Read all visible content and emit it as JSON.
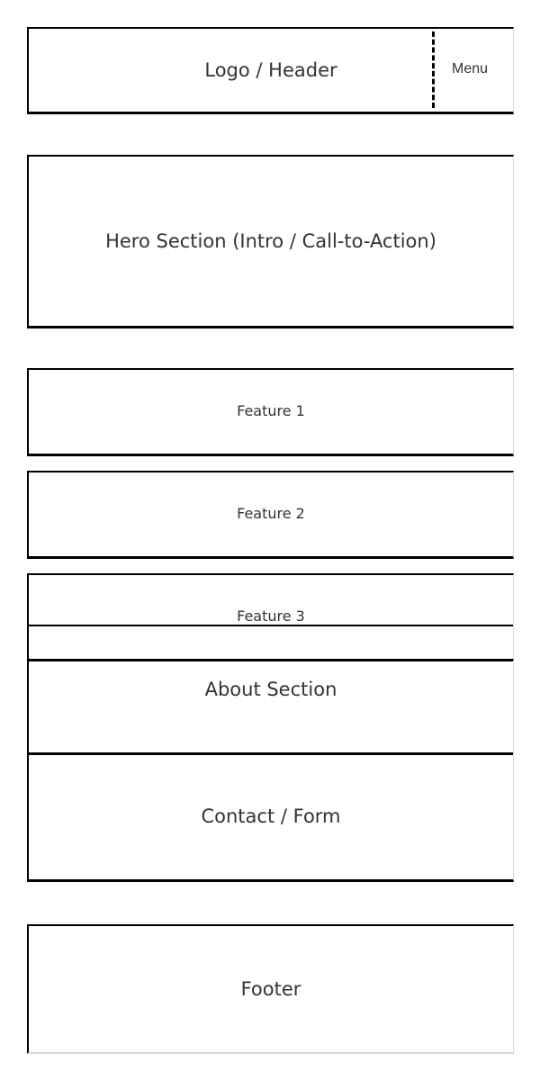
{
  "header": {
    "title": "Logo / Header",
    "menu_label": "Menu"
  },
  "hero": {
    "title": "Hero Section (Intro / Call-to-Action)"
  },
  "features": [
    {
      "label": "Feature 1"
    },
    {
      "label": "Feature 2"
    },
    {
      "label": "Feature 3"
    }
  ],
  "about": {
    "title": "About Section"
  },
  "contact": {
    "title": "Contact / Form"
  },
  "footer": {
    "title": "Footer"
  }
}
